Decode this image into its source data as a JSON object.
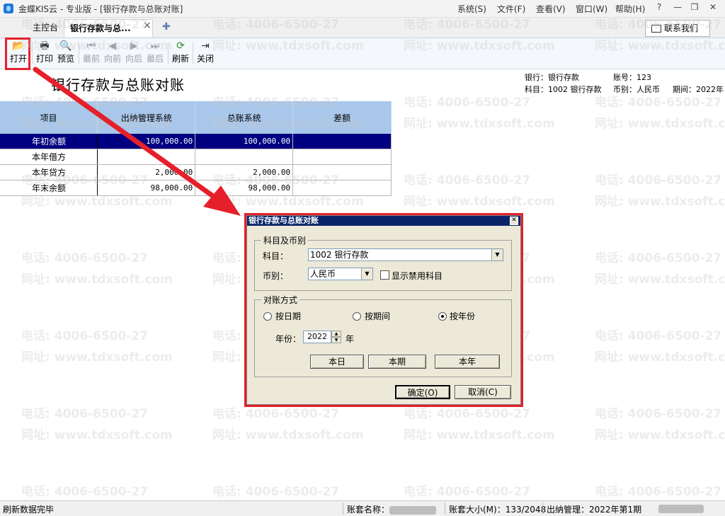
{
  "app": {
    "title": "金蝶KIS云 - 专业版 - [银行存款与总账对账]",
    "menus": [
      "系统(S)",
      "文件(F)",
      "查看(V)",
      "窗口(W)",
      "帮助(H)"
    ],
    "window_controls": [
      "?",
      "—",
      "❐",
      "✕"
    ]
  },
  "tabs": [
    {
      "label": "主控台"
    },
    {
      "label": "银行存款与总...",
      "close": "×"
    }
  ],
  "tab_add": "✚",
  "contact": {
    "label": "联系我们"
  },
  "toolbar": {
    "open": "打开",
    "print": "打印",
    "preview": "预览",
    "first": "最前",
    "prev": "向前",
    "next": "向后",
    "last": "最后",
    "refresh": "刷新",
    "close": "关闭"
  },
  "report": {
    "title": "银行存款与总账对账",
    "bank_label": "银行：银行存款",
    "account_no": "账号：123",
    "subject": "科目：1002 银行存款",
    "currency": "币别：人民币",
    "period": "期间：2022年"
  },
  "table": {
    "headers": [
      "项目",
      "出纳管理系统",
      "总账系统",
      "差额"
    ],
    "rows": [
      [
        "年初余额",
        "100,000.00",
        "100,000.00",
        ""
      ],
      [
        "本年借方",
        "",
        "",
        ""
      ],
      [
        "本年贷方",
        "2,000.00",
        "2,000.00",
        ""
      ],
      [
        "年末余额",
        "98,000.00",
        "98,000.00",
        ""
      ]
    ]
  },
  "watermark": {
    "phone": "电话: 4006-6500-27",
    "site": "网址: www.tdxsoft.com"
  },
  "dialog": {
    "title": "银行存款与总账对账",
    "close": "✕",
    "group1": "科目及币别",
    "subject_label": "科目：",
    "subject_value": "1002 银行存款",
    "currency_label": "币别：",
    "currency_value": "人民币",
    "show_disabled": "显示禁用科目",
    "group2": "对账方式",
    "by_date": "按日期",
    "by_period": "按期间",
    "by_year": "按年份",
    "year_label": "年份：",
    "year_value": "2022",
    "year_unit": "年",
    "btn_today": "本日",
    "btn_period": "本期",
    "btn_year": "本年",
    "ok": "确定(O)",
    "cancel": "取消(C)"
  },
  "status": {
    "message": "刷新数据完毕",
    "book_name_label": "账套名称：",
    "book_size": "账套大小(M)：133/2048",
    "cashier": "出纳管理：2022年第1期"
  },
  "colors": {
    "highlight": "#e5202a",
    "selected_row": "#000080",
    "header": "#a9c7ea",
    "dialog_title": "#0a246a"
  }
}
